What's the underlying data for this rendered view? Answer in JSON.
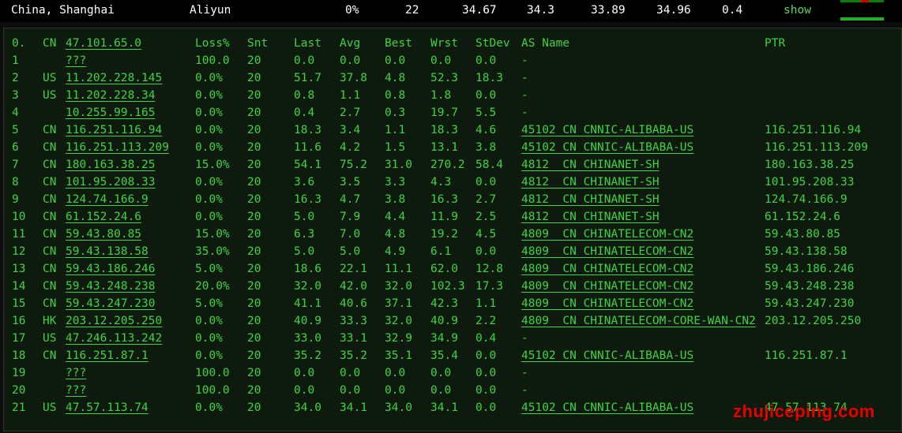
{
  "header": {
    "location": "China, Shanghai",
    "provider": "Aliyun",
    "loss": "0%",
    "sent": "22",
    "last": "34.67",
    "avg": "34.3",
    "best": "33.89",
    "worst": "34.96",
    "stdev": "0.4",
    "show_label": "show"
  },
  "columns": {
    "hop": "0.",
    "cc": "CN",
    "host": "47.101.65.0",
    "loss": "Loss%",
    "snt": "Snt",
    "last": "Last",
    "avg": "Avg",
    "best": "Best",
    "wrst": "Wrst",
    "stdev": "StDev",
    "as": "AS Name",
    "ptr": "PTR"
  },
  "rows": [
    {
      "hop": "1",
      "cc": "",
      "host": "???",
      "loss": "100.0",
      "snt": "20",
      "last": "0.0",
      "avg": "0.0",
      "best": "0.0",
      "wrst": "0.0",
      "stdev": "0.0",
      "as": "-",
      "ptr": ""
    },
    {
      "hop": "2",
      "cc": "US",
      "host": "11.202.228.145",
      "loss": "0.0%",
      "snt": "20",
      "last": "51.7",
      "avg": "37.8",
      "best": "4.8",
      "wrst": "52.3",
      "stdev": "18.3",
      "as": "-",
      "ptr": ""
    },
    {
      "hop": "3",
      "cc": "US",
      "host": "11.202.228.34",
      "loss": "0.0%",
      "snt": "20",
      "last": "0.8",
      "avg": "1.1",
      "best": "0.8",
      "wrst": "1.8",
      "stdev": "0.0",
      "as": "-",
      "ptr": ""
    },
    {
      "hop": "4",
      "cc": "",
      "host": "10.255.99.165",
      "loss": "0.0%",
      "snt": "20",
      "last": "0.4",
      "avg": "2.7",
      "best": "0.3",
      "wrst": "19.7",
      "stdev": "5.5",
      "as": "-",
      "ptr": ""
    },
    {
      "hop": "5",
      "cc": "CN",
      "host": "116.251.116.94",
      "loss": "0.0%",
      "snt": "20",
      "last": "18.3",
      "avg": "3.4",
      "best": "1.1",
      "wrst": "18.3",
      "stdev": "4.6",
      "as": "45102 CN CNNIC-ALIBABA-US",
      "ptr": "116.251.116.94"
    },
    {
      "hop": "6",
      "cc": "CN",
      "host": "116.251.113.209",
      "loss": "0.0%",
      "snt": "20",
      "last": "11.6",
      "avg": "4.2",
      "best": "1.5",
      "wrst": "13.1",
      "stdev": "3.8",
      "as": "45102 CN CNNIC-ALIBABA-US",
      "ptr": "116.251.113.209"
    },
    {
      "hop": "7",
      "cc": "CN",
      "host": "180.163.38.25",
      "loss": "15.0%",
      "snt": "20",
      "last": "54.1",
      "avg": "75.2",
      "best": "31.0",
      "wrst": "270.2",
      "stdev": "58.4",
      "as": "4812  CN CHINANET-SH",
      "ptr": "180.163.38.25"
    },
    {
      "hop": "8",
      "cc": "CN",
      "host": "101.95.208.33",
      "loss": "0.0%",
      "snt": "20",
      "last": "3.6",
      "avg": "3.5",
      "best": "3.3",
      "wrst": "4.3",
      "stdev": "0.0",
      "as": "4812  CN CHINANET-SH",
      "ptr": "101.95.208.33"
    },
    {
      "hop": "9",
      "cc": "CN",
      "host": "124.74.166.9",
      "loss": "0.0%",
      "snt": "20",
      "last": "16.3",
      "avg": "4.7",
      "best": "3.8",
      "wrst": "16.3",
      "stdev": "2.7",
      "as": "4812  CN CHINANET-SH",
      "ptr": "124.74.166.9"
    },
    {
      "hop": "10",
      "cc": "CN",
      "host": "61.152.24.6",
      "loss": "0.0%",
      "snt": "20",
      "last": "5.0",
      "avg": "7.9",
      "best": "4.4",
      "wrst": "11.9",
      "stdev": "2.5",
      "as": "4812  CN CHINANET-SH",
      "ptr": "61.152.24.6"
    },
    {
      "hop": "11",
      "cc": "CN",
      "host": "59.43.80.85",
      "loss": "15.0%",
      "snt": "20",
      "last": "6.3",
      "avg": "7.0",
      "best": "4.8",
      "wrst": "19.2",
      "stdev": "4.5",
      "as": "4809  CN CHINATELECOM-CN2",
      "ptr": "59.43.80.85"
    },
    {
      "hop": "12",
      "cc": "CN",
      "host": "59.43.138.58",
      "loss": "35.0%",
      "snt": "20",
      "last": "5.0",
      "avg": "5.0",
      "best": "4.9",
      "wrst": "6.1",
      "stdev": "0.0",
      "as": "4809  CN CHINATELECOM-CN2",
      "ptr": "59.43.138.58"
    },
    {
      "hop": "13",
      "cc": "CN",
      "host": "59.43.186.246",
      "loss": "5.0%",
      "snt": "20",
      "last": "18.6",
      "avg": "22.1",
      "best": "11.1",
      "wrst": "62.0",
      "stdev": "12.8",
      "as": "4809  CN CHINATELECOM-CN2",
      "ptr": "59.43.186.246"
    },
    {
      "hop": "14",
      "cc": "CN",
      "host": "59.43.248.238",
      "loss": "20.0%",
      "snt": "20",
      "last": "32.0",
      "avg": "42.0",
      "best": "32.0",
      "wrst": "102.3",
      "stdev": "17.3",
      "as": "4809  CN CHINATELECOM-CN2",
      "ptr": "59.43.248.238"
    },
    {
      "hop": "15",
      "cc": "CN",
      "host": "59.43.247.230",
      "loss": "5.0%",
      "snt": "20",
      "last": "41.1",
      "avg": "40.6",
      "best": "37.1",
      "wrst": "42.3",
      "stdev": "1.1",
      "as": "4809  CN CHINATELECOM-CN2",
      "ptr": "59.43.247.230"
    },
    {
      "hop": "16",
      "cc": "HK",
      "host": "203.12.205.250",
      "loss": "0.0%",
      "snt": "20",
      "last": "40.9",
      "avg": "33.3",
      "best": "32.0",
      "wrst": "40.9",
      "stdev": "2.2",
      "as": "4809  CN CHINATELECOM-CORE-WAN-CN2",
      "ptr": "203.12.205.250"
    },
    {
      "hop": "17",
      "cc": "US",
      "host": "47.246.113.242",
      "loss": "0.0%",
      "snt": "20",
      "last": "33.0",
      "avg": "33.1",
      "best": "32.9",
      "wrst": "34.9",
      "stdev": "0.4",
      "as": "-",
      "ptr": ""
    },
    {
      "hop": "18",
      "cc": "CN",
      "host": "116.251.87.1",
      "loss": "0.0%",
      "snt": "20",
      "last": "35.2",
      "avg": "35.2",
      "best": "35.1",
      "wrst": "35.4",
      "stdev": "0.0",
      "as": "45102 CN CNNIC-ALIBABA-US",
      "ptr": "116.251.87.1"
    },
    {
      "hop": "19",
      "cc": "",
      "host": "???",
      "loss": "100.0",
      "snt": "20",
      "last": "0.0",
      "avg": "0.0",
      "best": "0.0",
      "wrst": "0.0",
      "stdev": "0.0",
      "as": "-",
      "ptr": ""
    },
    {
      "hop": "20",
      "cc": "",
      "host": "???",
      "loss": "100.0",
      "snt": "20",
      "last": "0.0",
      "avg": "0.0",
      "best": "0.0",
      "wrst": "0.0",
      "stdev": "0.0",
      "as": "-",
      "ptr": ""
    },
    {
      "hop": "21",
      "cc": "US",
      "host": "47.57.113.74",
      "loss": "0.0%",
      "snt": "20",
      "last": "34.0",
      "avg": "34.1",
      "best": "34.0",
      "wrst": "34.1",
      "stdev": "0.0",
      "as": "45102 CN CNNIC-ALIBABA-US",
      "ptr": "47.57.113.74"
    }
  ],
  "watermark": "zhujiceping.com",
  "colors": {
    "text": "#3fd43f",
    "header_text": "#ffffff",
    "watermark": "#e60000",
    "background": "#0f1a0f"
  }
}
